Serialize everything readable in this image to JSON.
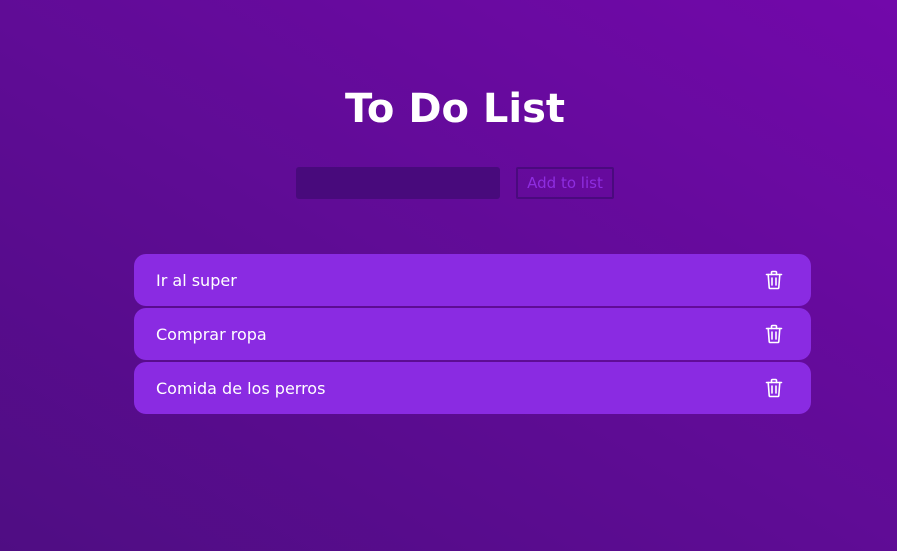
{
  "app": {
    "title": "To Do List"
  },
  "form": {
    "input_value": "",
    "input_placeholder": "",
    "add_button_label": "Add to list"
  },
  "todos": [
    {
      "text": "Ir al super",
      "icon": "trash-icon"
    },
    {
      "text": "Comprar ropa",
      "icon": "trash-icon"
    },
    {
      "text": "Comida de los perros",
      "icon": "trash-icon"
    }
  ],
  "colors": {
    "background_start": "#4f0d83",
    "background_end": "#7208aa",
    "input_background": "#480a7c",
    "button_text": "#8e2de0",
    "item_background": "#8a2be2",
    "text": "#ffffff"
  }
}
